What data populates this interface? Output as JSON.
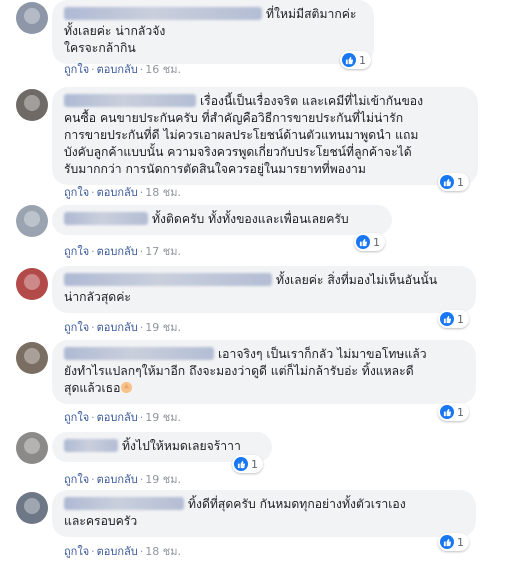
{
  "comments": [
    {
      "text": "ที่ใหม่มีสติมากค่ะ ทั้งเลยค่ะ น่ากลัวจัง ใครจะกล้ากิน",
      "line1": "ที่ใหม่มีสติมากค่ะ",
      "line2": "ทั้งเลยค่ะ น่ากลัวจัง",
      "line3": "ใครจะกล้ากิน",
      "reactions": "1",
      "like": "ถูกใจ",
      "reply": "ตอบกลับ",
      "time": "16 ชม."
    },
    {
      "line1": "เรื่องนี้เป็นเรื่องจริต และเคมีที่ไม่เข้ากันของ",
      "line2": "คนซื้อ คนขายประกันครับ ที่สำคัญคือวิธีการขายประกันที่ไม่น่ารัก",
      "line3": "การขายประกันที่ดี ไม่ควรเอาผลประโยชน์ด้านตัวแทนมาพูดนำ แถม",
      "line4": "บังคับลูกค้าแบบนั้น ความจริงควรพูดเกี่ยวกับประโยชน์ที่ลูกค้าจะได้",
      "line5": "รับมากกว่า การนัดการตัดสินใจควรอยู่ในมารยาทที่พองาม",
      "reactions": "1",
      "like": "ถูกใจ",
      "reply": "ตอบกลับ",
      "time": "18 ชม."
    },
    {
      "line1": "ทั้งติดครับ ทั้งทั้งของและเพื่อนเลยครับ",
      "reactions": "1",
      "like": "ถูกใจ",
      "reply": "ตอบกลับ",
      "time": "17 ชม."
    },
    {
      "line1": "ทั้งเลยค่ะ สิ่งที่มองไม่เห็นอันนั้น",
      "line2": "น่ากลัวสุดค่ะ",
      "reactions": "1",
      "like": "ถูกใจ",
      "reply": "ตอบกลับ",
      "time": "19 ชม."
    },
    {
      "line1": "เอาจริงๆ เป็นเราก็กลัว ไม่มาขอโทษแล้ว",
      "line2": "ยังทำไรแปลกๆให้มาอีก ถึงจะมองว่าดูดี แต่ก็ไม่กล้ารับอ่ะ ทิ้งแหละดี",
      "line3": "สุดแล้วเธอ",
      "reactions": "1",
      "like": "ถูกใจ",
      "reply": "ตอบกลับ",
      "time": "19 ชม."
    },
    {
      "line1": "ทิ้งไปให้หมดเลยจร้าาา",
      "reactions": "1",
      "like": "ถูกใจ",
      "reply": "ตอบกลับ",
      "time": "19 ชม."
    },
    {
      "line1": "ทิ้งดีที่สุดครับ กันหมดทุกอย่างทั้งตัวเราเอง",
      "line2": "และครอบครัว",
      "reactions": "1",
      "like": "ถูกใจ",
      "reply": "ตอบกลับ",
      "time": "18 ชม."
    }
  ],
  "colors": {
    "bubble": "#f2f3f5",
    "like_blue": "#1877f2",
    "action_link": "#385898",
    "meta_gray": "#90949c"
  },
  "icons": {
    "reaction": "like-thumb-icon",
    "emoji": "clapping-hands-emoji"
  }
}
